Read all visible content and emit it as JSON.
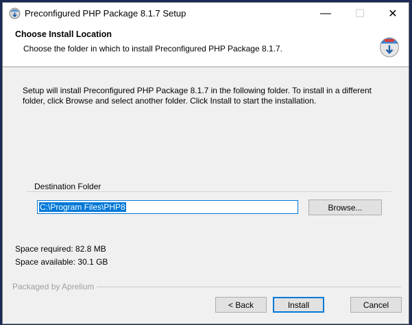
{
  "titlebar": {
    "title": "Preconfigured PHP Package 8.1.7 Setup",
    "minimize": "—",
    "maximize": "☐",
    "close": "✕"
  },
  "header": {
    "title": "Choose Install Location",
    "subtitle": "Choose the folder in which to install Preconfigured PHP Package 8.1.7."
  },
  "body": {
    "text": "Setup will install Preconfigured PHP Package 8.1.7 in the following folder. To install in a different folder, click Browse and select another folder. Click Install to start the installation."
  },
  "destination": {
    "label": "Destination Folder",
    "value": "C:\\Program Files\\PHP8",
    "browse_label": "Browse..."
  },
  "space": {
    "required": "Space required: 82.8 MB",
    "available": "Space available: 30.1 GB"
  },
  "footer": {
    "branding": "Packaged by Aprelium",
    "back_label": "< Back",
    "install_label": "Install",
    "cancel_label": "Cancel"
  },
  "colors": {
    "accent": "#0078d7",
    "desktop": "#1b2a55"
  }
}
